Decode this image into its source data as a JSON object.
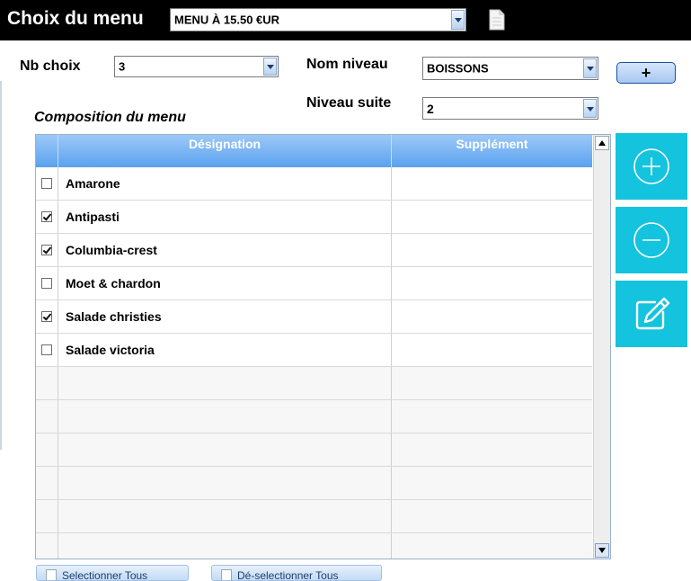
{
  "header": {
    "title": "Choix du menu",
    "menu_value": "MENU À 15.50 €UR"
  },
  "form": {
    "nb_choix_label": "Nb choix",
    "nb_choix_value": "3",
    "nom_niveau_label": "Nom niveau",
    "nom_niveau_value": "BOISSONS",
    "niveau_suite_label": "Niveau suite",
    "niveau_suite_value": "2",
    "add_button_label": "+"
  },
  "composition": {
    "title": "Composition du menu",
    "columns": [
      "Désignation",
      "Supplément"
    ],
    "rows": [
      {
        "name": "Amarone",
        "checked": false,
        "supplement": ""
      },
      {
        "name": "Antipasti",
        "checked": true,
        "supplement": ""
      },
      {
        "name": "Columbia-crest",
        "checked": true,
        "supplement": ""
      },
      {
        "name": "Moet & chardon",
        "checked": false,
        "supplement": ""
      },
      {
        "name": "Salade christies",
        "checked": true,
        "supplement": ""
      },
      {
        "name": "Salade victoria",
        "checked": false,
        "supplement": ""
      }
    ],
    "empty_rows": 6
  },
  "actions": {
    "add_icon": "plus-circle-icon",
    "remove_icon": "minus-circle-icon",
    "edit_icon": "edit-icon"
  },
  "bottom": {
    "select_all": "Selectionner Tous",
    "deselect_all": "Dé-selectionner Tous"
  },
  "colors": {
    "header_bg": "#000000",
    "accent_cyan": "#14c3de",
    "grid_header": "#5aa2ee"
  }
}
